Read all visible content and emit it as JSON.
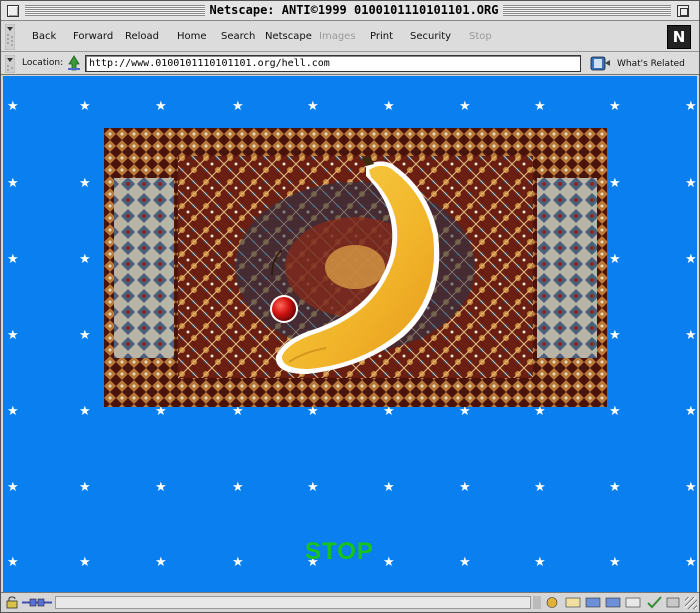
{
  "window": {
    "title": "Netscape: ANTI©1999 0100101110101101.ORG"
  },
  "toolbar": {
    "buttons": [
      {
        "label": "Back",
        "enabled": true
      },
      {
        "label": "Forward",
        "enabled": true
      },
      {
        "label": "Reload",
        "enabled": true
      },
      {
        "label": "Home",
        "enabled": true
      },
      {
        "label": "Search",
        "enabled": true
      },
      {
        "label": "Netscape",
        "enabled": true
      },
      {
        "label": "Images",
        "enabled": false
      },
      {
        "label": "Print",
        "enabled": true
      },
      {
        "label": "Security",
        "enabled": true
      },
      {
        "label": "Stop",
        "enabled": false
      }
    ],
    "logo_letter": "N"
  },
  "location": {
    "label": "Location:",
    "url": "http://www.0100101110101101.org/hell.com",
    "related_label": "What's Related"
  },
  "page": {
    "background_color": "#0a7ff0",
    "stop_text": "STOP",
    "stop_color": "#17c417",
    "image_subjects": [
      "persian-rug",
      "banana",
      "cherry"
    ]
  },
  "statusbar": {
    "text": ""
  }
}
